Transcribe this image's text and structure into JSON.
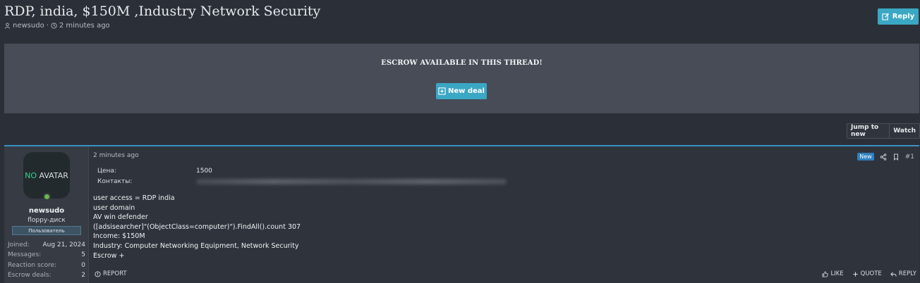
{
  "thread": {
    "title": "RDP, india, $150M ,Industry Network Security",
    "author": "newsudo",
    "time": "2 minutes ago"
  },
  "header": {
    "reply_label": "Reply"
  },
  "escrow": {
    "notice": "ESCROW AVAILABLE IN THIS THREAD!",
    "new_deal_label": "New deal"
  },
  "nav_buttons": {
    "jump_label": "Jump to new",
    "watch_label": "Watch"
  },
  "post": {
    "avatar_text_prefix": "NO",
    "avatar_text_suffix": "AVATAR",
    "username": "newsudo",
    "user_title": "floppy-диск",
    "user_badge": "Пользователь",
    "stats": [
      {
        "label": "Joined:",
        "value": "Aug 21, 2024"
      },
      {
        "label": "Messages:",
        "value": "5"
      },
      {
        "label": "Reaction score:",
        "value": "0"
      },
      {
        "label": "Escrow deals:",
        "value": "2"
      }
    ],
    "date": "2 minutes ago",
    "new_badge": "New",
    "number": "#1",
    "fields": [
      {
        "label": "Цена:",
        "value": "1500"
      },
      {
        "label": "Контакты:",
        "value": ""
      }
    ],
    "body_lines": [
      "user access = RDP india",
      "user domain",
      "AV win defender",
      "([adsisearcher]\"(ObjectClass=computer)\").FindAll().count 307",
      "Income: $150M",
      "Industry: Computer Networking Equipment, Network Security",
      "Escrow +"
    ],
    "footer": {
      "report": "REPORT",
      "like": "LIKE",
      "quote": "QUOTE",
      "reply": "REPLY"
    }
  },
  "colors": {
    "accent": "#3aa7c4",
    "post_border": "#3a8fc4",
    "online": "#6bb84a"
  }
}
